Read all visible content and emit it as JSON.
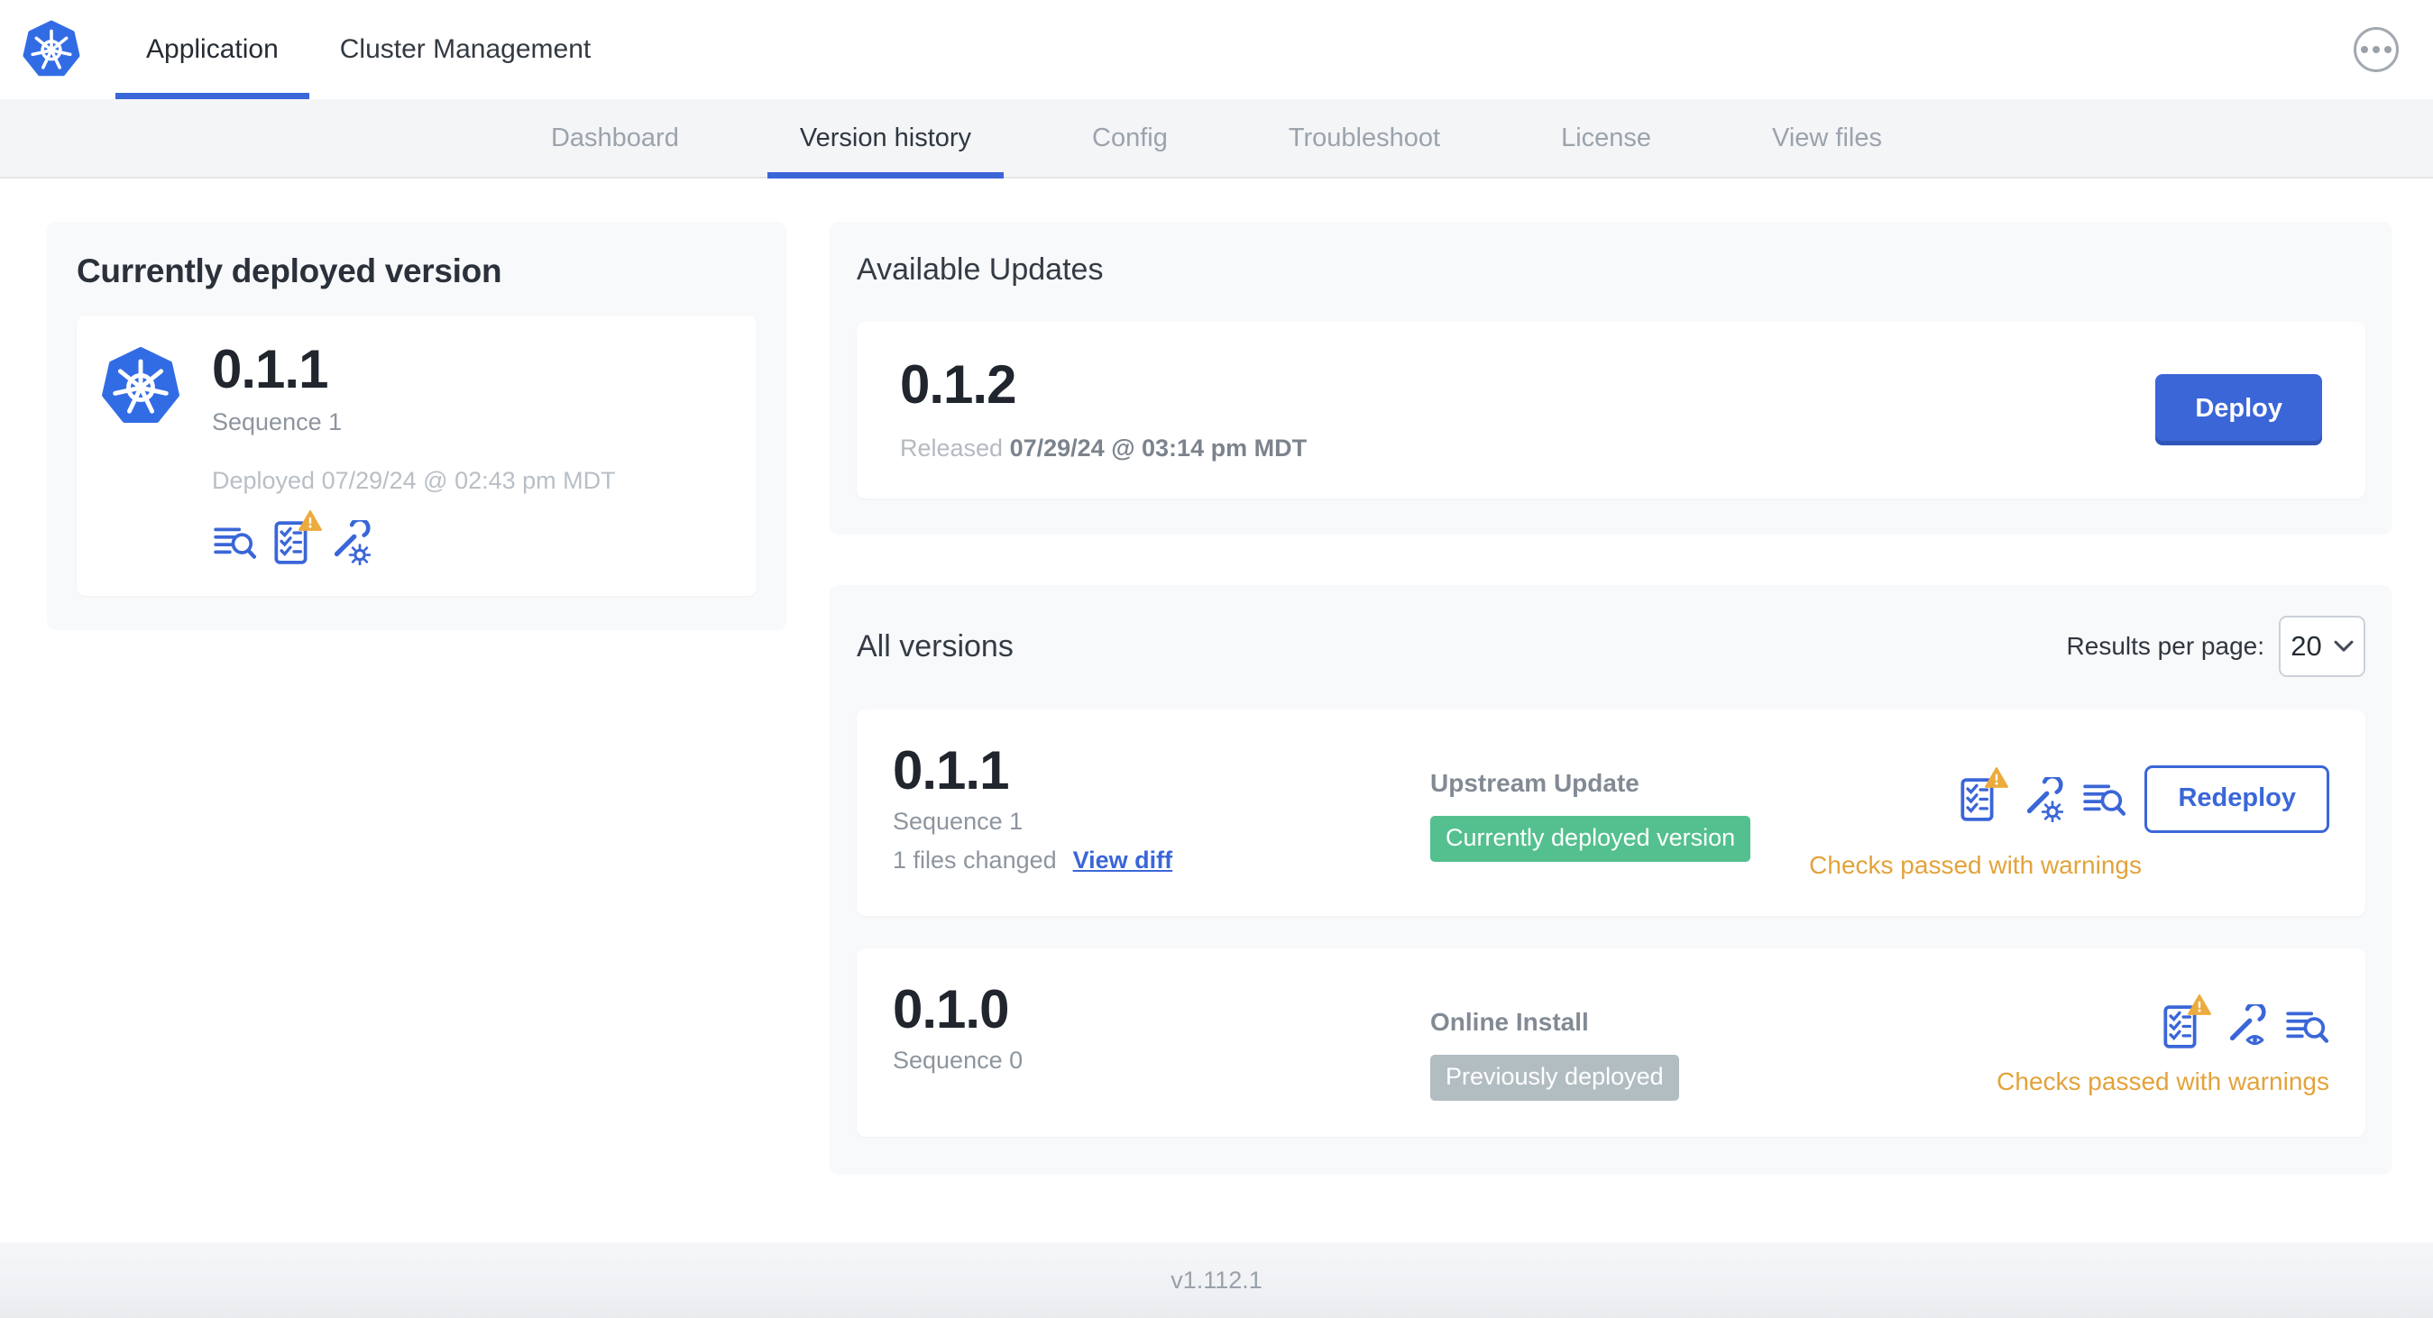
{
  "header": {
    "tabs": [
      {
        "label": "Application",
        "active": true
      },
      {
        "label": "Cluster Management",
        "active": false
      }
    ],
    "menu_icon": "ellipsis-circle"
  },
  "subnav": {
    "tabs": [
      {
        "label": "Dashboard",
        "active": false
      },
      {
        "label": "Version history",
        "active": true
      },
      {
        "label": "Config",
        "active": false
      },
      {
        "label": "Troubleshoot",
        "active": false
      },
      {
        "label": "License",
        "active": false
      },
      {
        "label": "View files",
        "active": false
      }
    ]
  },
  "current_version_card": {
    "title": "Currently deployed version",
    "version": "0.1.1",
    "sequence": "Sequence 1",
    "deployed": "Deployed 07/29/24 @ 02:43 pm MDT",
    "icons": [
      "release-notes",
      "preflight-checks-warning",
      "edit-config-wrench-gear"
    ]
  },
  "available_updates": {
    "title": "Available Updates",
    "update": {
      "version": "0.1.2",
      "released_label": "Released",
      "released_date": "07/29/24 @ 03:14 pm MDT",
      "deploy_label": "Deploy"
    }
  },
  "all_versions": {
    "title": "All versions",
    "results_per_page_label": "Results per page:",
    "results_per_page_value": "20",
    "rows": [
      {
        "version": "0.1.1",
        "sequence": "Sequence 1",
        "files_changed": "1 files changed",
        "view_diff_label": "View diff",
        "source": "Upstream Update",
        "badge_label": "Currently deployed version",
        "badge_color": "green",
        "icons": [
          "preflight-checks-warning",
          "edit-config-wrench-gear",
          "release-notes"
        ],
        "action_label": "Redeploy",
        "status": "Checks passed with warnings"
      },
      {
        "version": "0.1.0",
        "sequence": "Sequence 0",
        "source": "Online Install",
        "badge_label": "Previously deployed",
        "badge_color": "gray",
        "icons": [
          "preflight-checks-warning",
          "view-config-wrench-eye",
          "release-notes"
        ],
        "status": "Checks passed with warnings"
      }
    ]
  },
  "footer": {
    "app_version": "v1.112.1"
  },
  "colors": {
    "accent_blue": "#3a66d8",
    "kubernetes_blue": "#326ce5",
    "badge_green": "#54c08f",
    "badge_gray": "#b2bdc2",
    "warning_amber": "#e2a33b",
    "subnav_bg": "#f4f5f7",
    "panel_bg": "#f8f9fb"
  }
}
